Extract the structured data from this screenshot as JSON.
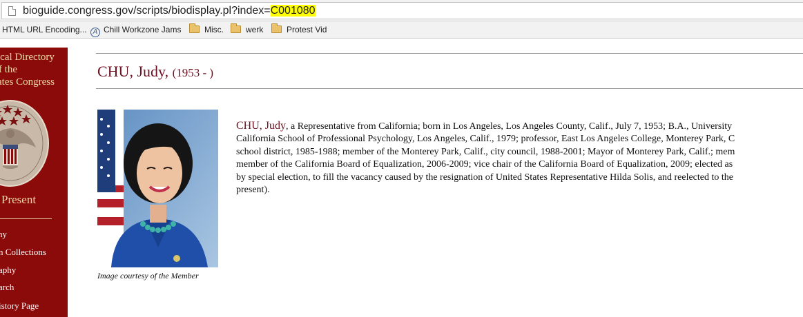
{
  "browser": {
    "url_prefix": "bioguide.congress.gov/scripts/biodisplay.pl?index=",
    "url_highlight": "C001080",
    "bookmarks": [
      {
        "label": "HTML URL Encoding...",
        "icon": "page-icon"
      },
      {
        "label": "Chill Workzone Jams",
        "icon": "circle-a-icon"
      },
      {
        "label": "Misc.",
        "icon": "folder-icon"
      },
      {
        "label": "werk",
        "icon": "folder-icon"
      },
      {
        "label": "Protest Vid",
        "icon": "folder-icon"
      }
    ]
  },
  "sidebar": {
    "title_lines": [
      "ical Directory",
      "f the",
      "ates Congress"
    ],
    "present": "Present",
    "links": [
      "hy",
      "n Collections",
      "aphy",
      "arch",
      "istory Page"
    ],
    "colors": {
      "background": "#8b0a0a",
      "text": "#f0d9a8"
    }
  },
  "main": {
    "name": "CHU, Judy",
    "years": "(1953 - )",
    "photo_caption": "Image courtesy of the Member",
    "bio_name": "CHU, Judy",
    "bio_lines": [
      ", a Representative from California; born in Los Angeles, Los Angeles County, Calif., July 7, 1953; B.A., University",
      "California School of Professional Psychology, Los Angeles, Calif., 1979; professor, East Los Angeles College, Monterey Park, C",
      "school district, 1985-1988; member of the Monterey Park, Calif., city council, 1988-2001; Mayor of Monterey Park, Calif.; mem",
      "member of the California Board of Equalization, 2006-2009; vice chair of the California Board of Equalization, 2009; elected as",
      "by special election, to fill the vacancy caused by the resignation of United States Representative Hilda Solis, and reelected to the",
      "present)."
    ],
    "colors": {
      "name": "#6e1121",
      "rule": "#9a9a9a"
    }
  }
}
